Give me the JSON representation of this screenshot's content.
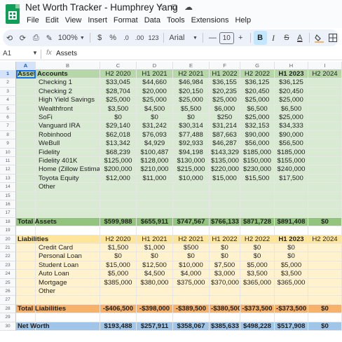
{
  "app": {
    "doc_title": "Net Worth Tracker - Humphrey Yang",
    "star_icon": "star-icon",
    "move_icon": "folder-move-icon",
    "cloud_icon": "cloud-saved-icon",
    "menu": [
      "File",
      "Edit",
      "View",
      "Insert",
      "Format",
      "Data",
      "Tools",
      "Extensions",
      "Help"
    ]
  },
  "toolbar": {
    "undo": "⟲",
    "redo": "⟳",
    "print": "⎙",
    "paint_format": "✎",
    "zoom": "100%",
    "currency": "$",
    "percent": "%",
    "decrease_decimals": ".0",
    "increase_decimals": ".00",
    "number_format": "123",
    "font": "Arial",
    "font_size_minus": "—",
    "font_size": "10",
    "font_size_plus": "+",
    "bold": "B",
    "italic": "I",
    "strikethrough": "S",
    "text_color": "A",
    "fill_color_icon": "paint-bucket-icon",
    "borders_icon": "borders-icon"
  },
  "formula_bar": {
    "name_box": "A1",
    "fx": "fx",
    "content": "Assets"
  },
  "columns": [
    "A",
    "B",
    "C",
    "D",
    "E",
    "F",
    "G",
    "H",
    "I"
  ],
  "colors": {
    "assets_green": "#d9ead3",
    "assets_header_green": "#b6d7a8",
    "total_assets_green": "#93c47d",
    "liabilities_yellow": "#fff2cc",
    "liabilities_header_yellow": "#ffe599",
    "total_liabilities_orange": "#f6b26b",
    "net_worth_blue": "#9fc5e8",
    "selection": "#1a73e8"
  },
  "rows": [
    {
      "n": "1",
      "a": "Assets",
      "b": "Accounts",
      "vals": [
        "H2 2020",
        "H1 2021",
        "H2 2021",
        "H1 2022",
        "H2 2022",
        "H1 2023",
        "H2 2024"
      ]
    },
    {
      "n": "2",
      "a": "",
      "b": "Checking 1",
      "vals": [
        "$33,045",
        "$44,660",
        "$46,984",
        "$36,155",
        "$36,125",
        "$36,125",
        ""
      ]
    },
    {
      "n": "3",
      "a": "",
      "b": "Checking 2",
      "vals": [
        "$28,704",
        "$20,000",
        "$20,150",
        "$20,235",
        "$20,450",
        "$20,450",
        ""
      ]
    },
    {
      "n": "4",
      "a": "",
      "b": "High Yield Savings",
      "vals": [
        "$25,000",
        "$25,000",
        "$25,000",
        "$25,000",
        "$25,000",
        "$25,000",
        ""
      ]
    },
    {
      "n": "5",
      "a": "",
      "b": "Wealthfront",
      "vals": [
        "$3,500",
        "$4,500",
        "$5,500",
        "$6,000",
        "$6,500",
        "$6,500",
        ""
      ]
    },
    {
      "n": "6",
      "a": "",
      "b": "SoFi",
      "vals": [
        "$0",
        "$0",
        "$0",
        "$250",
        "$25,000",
        "$25,000",
        ""
      ]
    },
    {
      "n": "7",
      "a": "",
      "b": "Vanguard IRA",
      "vals": [
        "$29,140",
        "$31,242",
        "$30,314",
        "$31,214",
        "$32,153",
        "$34,333",
        ""
      ]
    },
    {
      "n": "8",
      "a": "",
      "b": "Robinhood",
      "vals": [
        "$62,018",
        "$76,093",
        "$77,488",
        "$87,663",
        "$90,000",
        "$90,000",
        ""
      ]
    },
    {
      "n": "9",
      "a": "",
      "b": "WeBull",
      "vals": [
        "$13,342",
        "$4,929",
        "$92,933",
        "$46,287",
        "$56,000",
        "$56,500",
        ""
      ]
    },
    {
      "n": "10",
      "a": "",
      "b": "Fidelity",
      "vals": [
        "$68,239",
        "$100,487",
        "$94,198",
        "$143,329",
        "$185,000",
        "$185,000",
        ""
      ]
    },
    {
      "n": "11",
      "a": "",
      "b": "Fidelity 401K",
      "vals": [
        "$125,000",
        "$128,000",
        "$130,000",
        "$135,000",
        "$150,000",
        "$155,000",
        ""
      ]
    },
    {
      "n": "12",
      "a": "",
      "b": "Home (Zillow Estimate)",
      "vals": [
        "$200,000",
        "$210,000",
        "$215,000",
        "$220,000",
        "$230,000",
        "$240,000",
        ""
      ]
    },
    {
      "n": "13",
      "a": "",
      "b": "Toyota Equity",
      "vals": [
        "$12,000",
        "$11,000",
        "$10,000",
        "$15,000",
        "$15,500",
        "$17,500",
        ""
      ]
    },
    {
      "n": "14",
      "a": "",
      "b": "Other",
      "vals": [
        "",
        "",
        "",
        "",
        "",
        "",
        ""
      ]
    },
    {
      "n": "15",
      "a": "",
      "b": "",
      "vals": [
        "",
        "",
        "",
        "",
        "",
        "",
        ""
      ]
    },
    {
      "n": "16",
      "a": "",
      "b": "",
      "vals": [
        "",
        "",
        "",
        "",
        "",
        "",
        ""
      ]
    },
    {
      "n": "17",
      "a": "",
      "b": "",
      "vals": [
        "",
        "",
        "",
        "",
        "",
        "",
        ""
      ]
    },
    {
      "n": "18",
      "a": "Total Assets",
      "b": "",
      "vals": [
        "$599,988",
        "$655,911",
        "$747,567",
        "$766,133",
        "$871,728",
        "$891,408",
        "$0"
      ]
    },
    {
      "n": "19",
      "a": "",
      "b": "",
      "vals": [
        "",
        "",
        "",
        "",
        "",
        "",
        ""
      ]
    },
    {
      "n": "20",
      "a": "Liabilities",
      "b": "",
      "vals": [
        "H2 2020",
        "H1 2021",
        "H2 2021",
        "H1 2022",
        "H2 2022",
        "H1 2023",
        "H2 2024"
      ]
    },
    {
      "n": "21",
      "a": "",
      "b": "Credit Card",
      "vals": [
        "$1,500",
        "$1,000",
        "$500",
        "$0",
        "$0",
        "$0",
        ""
      ]
    },
    {
      "n": "22",
      "a": "",
      "b": "Personal Loan",
      "vals": [
        "$0",
        "$0",
        "$0",
        "$0",
        "$0",
        "$0",
        ""
      ]
    },
    {
      "n": "23",
      "a": "",
      "b": "Student Loan",
      "vals": [
        "$15,000",
        "$12,500",
        "$10,000",
        "$7,500",
        "$5,000",
        "$5,000",
        ""
      ]
    },
    {
      "n": "24",
      "a": "",
      "b": "Auto Loan",
      "vals": [
        "$5,000",
        "$4,500",
        "$4,000",
        "$3,000",
        "$3,500",
        "$3,500",
        ""
      ]
    },
    {
      "n": "25",
      "a": "",
      "b": "Mortgage",
      "vals": [
        "$385,000",
        "$380,000",
        "$375,000",
        "$370,000",
        "$365,000",
        "$365,000",
        ""
      ]
    },
    {
      "n": "26",
      "a": "",
      "b": "Other",
      "vals": [
        "",
        "",
        "",
        "",
        "",
        "",
        ""
      ]
    },
    {
      "n": "27",
      "a": "",
      "b": "",
      "vals": [
        "",
        "",
        "",
        "",
        "",
        "",
        ""
      ]
    },
    {
      "n": "28",
      "a": "Total Liabilities",
      "b": "",
      "vals": [
        "-$406,500",
        "-$398,000",
        "-$389,500",
        "-$380,500",
        "-$373,500",
        "-$373,500",
        "$0"
      ]
    },
    {
      "n": "29",
      "a": "",
      "b": "",
      "vals": [
        "",
        "",
        "",
        "",
        "",
        "",
        ""
      ]
    },
    {
      "n": "30",
      "a": "Net Worth",
      "b": "",
      "vals": [
        "$193,488",
        "$257,911",
        "$358,067",
        "$385,633",
        "$498,228",
        "$517,908",
        "$0"
      ]
    }
  ]
}
